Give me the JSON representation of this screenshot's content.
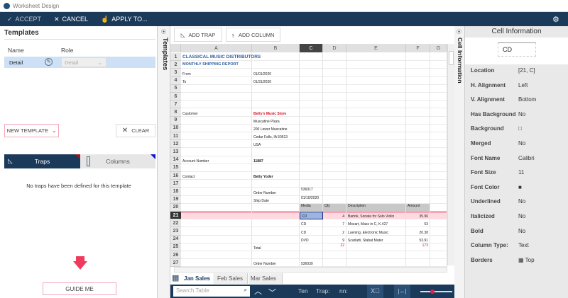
{
  "window": {
    "title": "Worksheet Design"
  },
  "toolbar": {
    "accept": "ACCEPT",
    "cancel": "CANCEL",
    "apply": "APPLY TO..."
  },
  "left": {
    "title": "Templates",
    "col_name": "Name",
    "col_role": "Role",
    "row": {
      "name": "Detail",
      "role": "Detail"
    },
    "new_template": "NEW TEMPLATE",
    "clear": "CLEAR",
    "tab_traps": "Traps",
    "tab_columns": "Columns",
    "empty": "No traps have been defined for this template",
    "guide": "GUIDE ME",
    "strip": "Templates"
  },
  "sheet": {
    "add_trap": "ADD TRAP",
    "add_column": "ADD COLUMN",
    "columns": [
      "A",
      "B",
      "C",
      "D",
      "E",
      "F",
      "G"
    ],
    "selected_col": "C",
    "selected_row": "21",
    "rows": [
      [
        "CLASSICAL MUSIC DISTRIBUTORS",
        "",
        "",
        "",
        "",
        "",
        ""
      ],
      [
        "MONTHLY SHIPPING REPORT",
        "",
        "",
        "",
        "",
        "",
        ""
      ],
      [
        "From",
        "01/01/2020",
        "",
        "",
        "",
        "",
        ""
      ],
      [
        "To",
        "01/31/2020",
        "",
        "",
        "",
        "",
        ""
      ],
      [
        "",
        "",
        "",
        "",
        "",
        "",
        ""
      ],
      [
        "",
        "",
        "",
        "",
        "",
        "",
        ""
      ],
      [
        "",
        "",
        "",
        "",
        "",
        "",
        ""
      ],
      [
        "Customer",
        "Betty's Music Store",
        "",
        "",
        "",
        "",
        ""
      ],
      [
        "",
        "Muscatine Plaza",
        "",
        "",
        "",
        "",
        ""
      ],
      [
        "",
        "200 Lower Muscatine",
        "",
        "",
        "",
        "",
        ""
      ],
      [
        "",
        "Cedar Falls, IA 50613",
        "",
        "",
        "",
        "",
        ""
      ],
      [
        "",
        "USA",
        "",
        "",
        "",
        "",
        ""
      ],
      [
        "",
        "",
        "",
        "",
        "",
        "",
        ""
      ],
      [
        "Account Number",
        "11887",
        "",
        "",
        "",
        "",
        ""
      ],
      [
        "",
        "",
        "",
        "",
        "",
        "",
        ""
      ],
      [
        "Contact",
        "Betty Yoder",
        "",
        "",
        "",
        "",
        ""
      ],
      [
        "",
        "",
        "",
        "",
        "",
        "",
        ""
      ],
      [
        "",
        "Order Number",
        "536017",
        "",
        "",
        "",
        ""
      ],
      [
        "",
        "Ship Date",
        "01/10/2020",
        "",
        "",
        "",
        ""
      ],
      [
        "",
        "",
        "Media",
        "Qty",
        "Description",
        "Amount",
        ""
      ],
      [
        "",
        "",
        "CD",
        "4",
        "Bartok, Sonata for Solo Violin",
        "35.96",
        ""
      ],
      [
        "",
        "",
        "CD",
        "7",
        "Mozart, Mass in C, K.427",
        "63",
        ""
      ],
      [
        "",
        "",
        "CD",
        "2",
        "Luening, Electronic Music",
        "20.38",
        ""
      ],
      [
        "",
        "",
        "DVD",
        "9",
        "Scarlatti, Stabat Mater",
        "53.91",
        ""
      ],
      [
        "",
        "Total",
        "",
        "22",
        "",
        "173",
        ""
      ],
      [
        "",
        "",
        "",
        "",
        "",
        "",
        ""
      ],
      [
        "",
        "Order Number",
        "536039",
        "",
        "",
        "",
        ""
      ]
    ],
    "tabs": [
      "Jan Sales",
      "Feb Sales",
      "Mar Sales"
    ],
    "search_placeholder": "Search Table",
    "status_ten": "Ten",
    "status_trap": "Trap:",
    "status_nn": "nn:"
  },
  "cell_info": {
    "title": "Cell Information",
    "value": "CD",
    "strip": "Cell Information",
    "props": [
      {
        "label": "Location",
        "value": "[21, C]"
      },
      {
        "label": "H. Alignment",
        "value": "Left"
      },
      {
        "label": "V. Alignment",
        "value": "Bottom"
      },
      {
        "label": "Has Background",
        "value": "No"
      },
      {
        "label": "Background",
        "value": "□"
      },
      {
        "label": "Merged",
        "value": "No"
      },
      {
        "label": "Font Name",
        "value": "Calibri"
      },
      {
        "label": "Font Size",
        "value": "11"
      },
      {
        "label": "Font Color",
        "value": "■"
      },
      {
        "label": "Underlined",
        "value": "No"
      },
      {
        "label": "Italicized",
        "value": "No"
      },
      {
        "label": "Bold",
        "value": "No"
      },
      {
        "label": "Column Type:",
        "value": "Text"
      },
      {
        "label": "Borders",
        "value": "▦ Top"
      }
    ]
  },
  "colors": {
    "navy": "#1b3a5a",
    "highlight": "#ffd9e0",
    "accent_red": "#e0234a"
  }
}
